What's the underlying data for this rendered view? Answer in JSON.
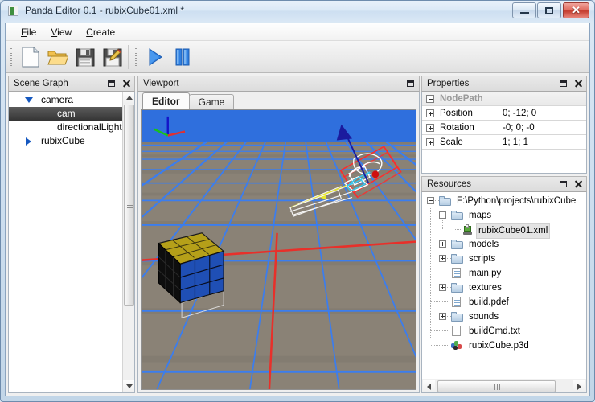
{
  "window": {
    "title": "Panda Editor 0.1 - rubixCube01.xml *",
    "app_icon": "panda-app-icon",
    "buttons": {
      "minimize": "minimize-icon",
      "maximize": "maximize-icon",
      "close": "✕"
    }
  },
  "menubar": {
    "items": [
      {
        "label": "File",
        "accel": "F"
      },
      {
        "label": "View",
        "accel": "V"
      },
      {
        "label": "Create",
        "accel": "C"
      }
    ]
  },
  "toolbar": {
    "buttons": [
      {
        "name": "new-file",
        "icon": "new-document-icon"
      },
      {
        "name": "open-file",
        "icon": "open-folder-icon"
      },
      {
        "name": "save",
        "icon": "floppy-save-icon"
      },
      {
        "name": "save-as",
        "icon": "floppy-save-as-icon"
      },
      {
        "name": "play",
        "icon": "play-icon"
      },
      {
        "name": "pause",
        "icon": "pause-icon"
      }
    ]
  },
  "scene_graph": {
    "title": "Scene Graph",
    "nodes": [
      {
        "label": "camera",
        "indent": 0,
        "expander": "down",
        "selected": false
      },
      {
        "label": "cam",
        "indent": 1,
        "expander": "none",
        "selected": true
      },
      {
        "label": "directionalLight",
        "indent": 1,
        "expander": "none",
        "selected": false
      },
      {
        "label": "rubixCube",
        "indent": 0,
        "expander": "right",
        "selected": false
      }
    ]
  },
  "viewport": {
    "title": "Viewport",
    "tabs": [
      {
        "label": "Editor",
        "active": true
      },
      {
        "label": "Game",
        "active": false
      }
    ],
    "scene": {
      "sky_color": "#2f6fdd",
      "ground_color": "#8b8274",
      "grid_color": "#3b7dee",
      "axis_x_color": "#e8302a",
      "objects": [
        {
          "name": "rubix-cube",
          "top_color": "#b5a019",
          "front_color": "#1f4fb5",
          "side_color": "#0e0e0e"
        },
        {
          "name": "camera-gizmo",
          "box_color": "#ff2b2b",
          "arrow_color": "#1b1b9e",
          "frustum_color": "#37c8f0",
          "dot_color": "#d01010",
          "ray_color": "#e8e82a"
        }
      ],
      "axis_indicator": {
        "z": "#1414c8",
        "x": "#e03030",
        "y": "#19c219"
      }
    }
  },
  "properties": {
    "title": "Properties",
    "group": "NodePath",
    "rows": [
      {
        "name": "Position",
        "value": "0; -12; 0"
      },
      {
        "name": "Rotation",
        "value": "-0; 0; -0"
      },
      {
        "name": "Scale",
        "value": "1; 1; 1"
      }
    ]
  },
  "resources": {
    "title": "Resources",
    "nodes": [
      {
        "label": "F:\\Python\\projects\\rubixCube",
        "indent": 0,
        "icon": "folder-icon",
        "expander": "minus",
        "selected": false
      },
      {
        "label": "maps",
        "indent": 1,
        "icon": "folder-icon",
        "expander": "minus",
        "selected": false
      },
      {
        "label": "rubixCube01.xml",
        "indent": 2,
        "icon": "xml-file-icon",
        "expander": "none",
        "selected": true
      },
      {
        "label": "models",
        "indent": 1,
        "icon": "folder-icon",
        "expander": "plus",
        "selected": false
      },
      {
        "label": "scripts",
        "indent": 1,
        "icon": "folder-icon",
        "expander": "plus",
        "selected": false
      },
      {
        "label": "main.py",
        "indent": 1,
        "icon": "text-file-icon",
        "expander": "none",
        "selected": false
      },
      {
        "label": "textures",
        "indent": 1,
        "icon": "folder-icon",
        "expander": "plus",
        "selected": false
      },
      {
        "label": "build.pdef",
        "indent": 1,
        "icon": "text-file-icon",
        "expander": "none",
        "selected": false
      },
      {
        "label": "sounds",
        "indent": 1,
        "icon": "folder-icon",
        "expander": "plus",
        "selected": false
      },
      {
        "label": "buildCmd.txt",
        "indent": 1,
        "icon": "blank-file-icon",
        "expander": "none",
        "selected": false
      },
      {
        "label": "rubixCube.p3d",
        "indent": 1,
        "icon": "p3d-file-icon",
        "expander": "none",
        "selected": false
      }
    ]
  },
  "panel_controls": {
    "float": "float-icon",
    "close": "close-icon"
  }
}
